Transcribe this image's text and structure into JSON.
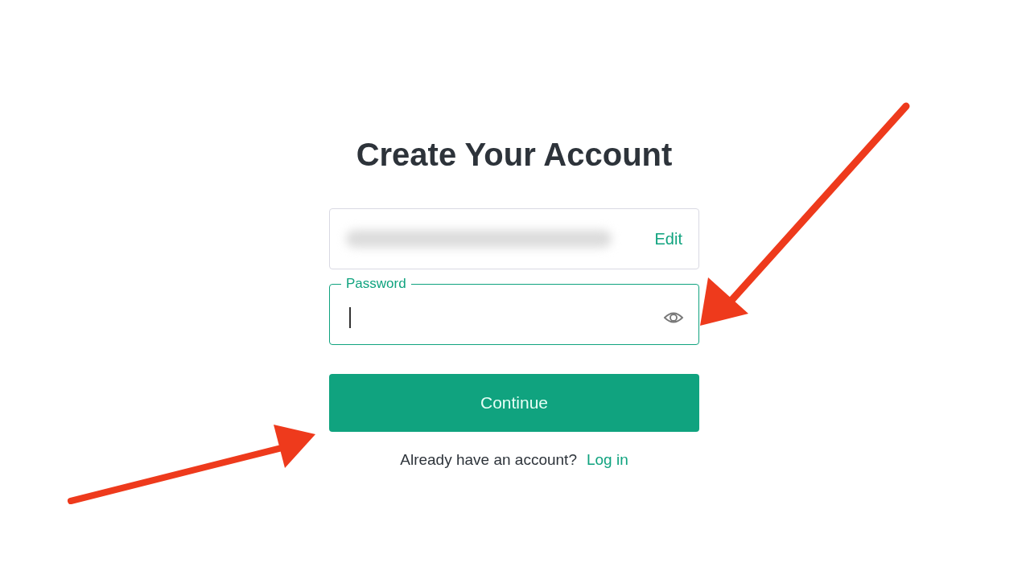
{
  "title": "Create Your Account",
  "email_field": {
    "action": "Edit"
  },
  "password_field": {
    "label": "Password"
  },
  "continue_button": {
    "label": "Continue"
  },
  "footer": {
    "text": "Already have an account?",
    "link": "Log in"
  }
}
